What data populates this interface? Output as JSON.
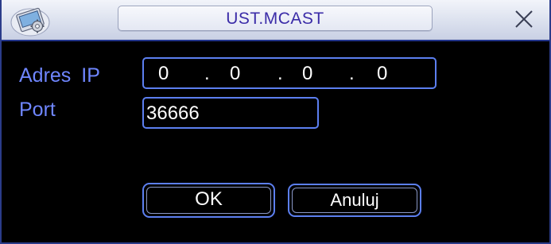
{
  "dialog": {
    "title": "UST.MCAST",
    "icons": {
      "app": "settings-gear-icon",
      "close": "close-icon"
    }
  },
  "form": {
    "ip_label": "Adres IP",
    "ip_octets": [
      "0",
      "0",
      "0",
      "0"
    ],
    "ip_separator": ".",
    "port_label": "Port",
    "port_value": "36666"
  },
  "buttons": {
    "ok_label": "OK",
    "cancel_label": "Anuluj"
  },
  "colors": {
    "label_text": "#6f86ff",
    "field_border": "#5c7ff0",
    "title_text": "#3b2ca8",
    "frame_border": "#2b3c8a",
    "background": "#000000"
  }
}
